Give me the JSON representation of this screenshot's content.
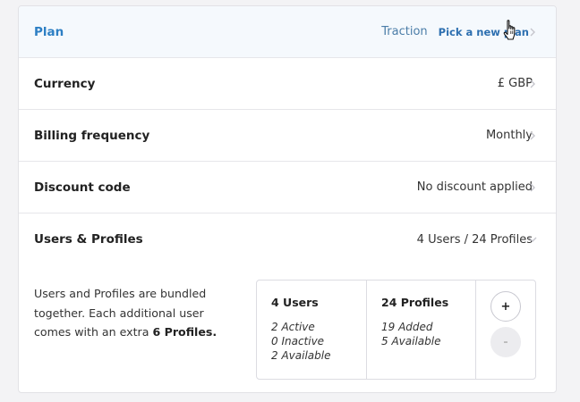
{
  "rows": {
    "plan": {
      "label": "Plan",
      "value": "Traction",
      "action": "Pick a new plan"
    },
    "currency": {
      "label": "Currency",
      "value": "£ GBP"
    },
    "billing": {
      "label": "Billing frequency",
      "value": "Monthly"
    },
    "discount": {
      "label": "Discount code",
      "value": "No discount applied"
    },
    "users": {
      "label": "Users & Profiles",
      "value": "4 Users / 24 Profiles"
    }
  },
  "bundle": {
    "text_before": "Users and Profiles are bundled together. Each additional user comes with an extra ",
    "text_bold": "6 Profiles."
  },
  "summary": {
    "users": {
      "title": "4 Users",
      "lines": [
        "2 Active",
        "0 Inactive",
        "2 Available"
      ]
    },
    "profiles": {
      "title": "24 Profiles",
      "lines": [
        "19 Added",
        "5 Available"
      ]
    },
    "plus_label": "+",
    "minus_label": "-"
  },
  "icons": {
    "chevron_right": "chevron-right-icon",
    "chevron_down": "chevron-down-icon",
    "cursor": "hand-pointer-icon"
  },
  "colors": {
    "accent": "#2d7fc4",
    "plan_row_bg": "#f5f9fd",
    "page_bg": "#f3f3f5"
  }
}
